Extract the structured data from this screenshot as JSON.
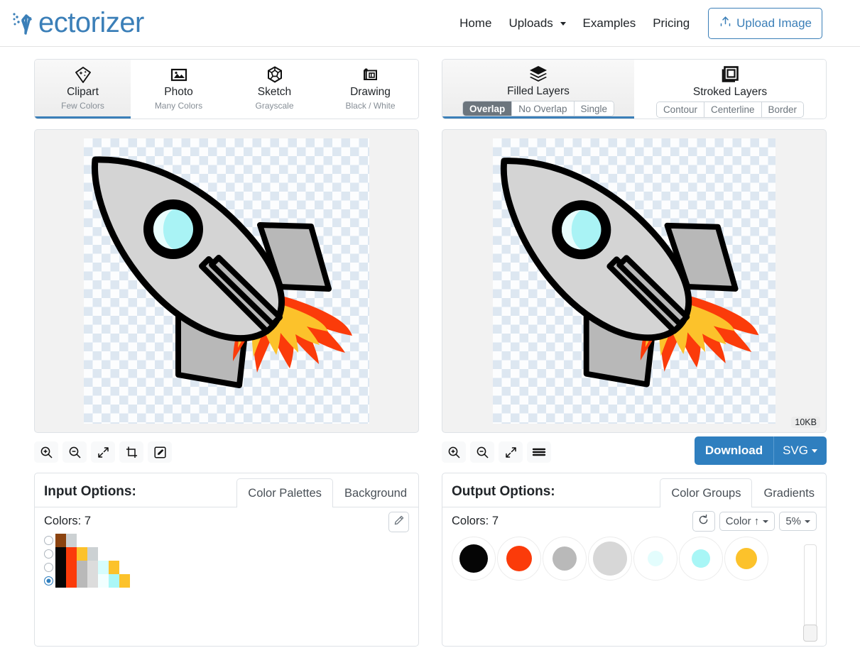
{
  "header": {
    "logo_text": "ectorizer",
    "logo_icon": "vectorizer-arrow-logo",
    "nav": [
      {
        "label": "Home",
        "caret": false
      },
      {
        "label": "Uploads",
        "caret": true
      },
      {
        "label": "Examples",
        "caret": false
      },
      {
        "label": "Pricing",
        "caret": false
      }
    ],
    "upload_button": "Upload Image",
    "upload_icon": "upload-arrow-icon"
  },
  "input_modes": [
    {
      "label": "Clipart",
      "sub": "Few Colors",
      "icon": "diamond-sparkle-icon",
      "active": true
    },
    {
      "label": "Photo",
      "sub": "Many Colors",
      "icon": "photo-icon",
      "active": false
    },
    {
      "label": "Sketch",
      "sub": "Grayscale",
      "icon": "hexagon-sketch-icon",
      "active": false
    },
    {
      "label": "Drawing",
      "sub": "Black / White",
      "icon": "blueprint-icon",
      "active": false
    }
  ],
  "output_modes": [
    {
      "label": "Filled Layers",
      "icon": "stacked-layers-icon",
      "active": true,
      "segments": [
        {
          "label": "Overlap",
          "on": true
        },
        {
          "label": "No Overlap",
          "on": false
        },
        {
          "label": "Single",
          "on": false
        }
      ]
    },
    {
      "label": "Stroked Layers",
      "icon": "nested-squares-icon",
      "active": false,
      "segments": [
        {
          "label": "Contour",
          "on": false
        },
        {
          "label": "Centerline",
          "on": false
        },
        {
          "label": "Border",
          "on": false
        }
      ]
    }
  ],
  "input_toolbar": [
    {
      "icon": "zoom-in-icon"
    },
    {
      "icon": "zoom-out-icon"
    },
    {
      "icon": "fit-expand-icon"
    },
    {
      "icon": "crop-icon"
    },
    {
      "icon": "edit-pencil-icon"
    }
  ],
  "output_toolbar": [
    {
      "icon": "zoom-in-icon"
    },
    {
      "icon": "zoom-out-icon"
    },
    {
      "icon": "fit-expand-icon"
    },
    {
      "icon": "hamburger-menu-icon"
    }
  ],
  "output_preview": {
    "size_badge": "10KB"
  },
  "download": {
    "label": "Download",
    "format": "SVG",
    "accent": "#2f7fbf"
  },
  "input_options": {
    "title": "Input Options:",
    "tabs": [
      {
        "label": "Color Palettes",
        "active": true
      },
      {
        "label": "Background",
        "active": false
      }
    ],
    "colors_label": "Colors: 7",
    "edit_icon": "pencil-icon",
    "palettes": [
      {
        "selected": false,
        "colors": [
          "#8b4310",
          "#ccd1d3"
        ]
      },
      {
        "selected": false,
        "colors": [
          "#060606",
          "#fb3b0a",
          "#fcc22b",
          "#ccd1d3"
        ]
      },
      {
        "selected": false,
        "colors": [
          "#060606",
          "#fb3b0a",
          "#b9b9b9",
          "#dcdcdc",
          "#d6fdfd",
          "#fcc22b"
        ]
      },
      {
        "selected": true,
        "colors": [
          "#060606",
          "#fb3b0a",
          "#b9b9b9",
          "#dcdcdc",
          "#f2ffff",
          "#aaf7f7",
          "#fcc22b"
        ]
      }
    ]
  },
  "output_options": {
    "title": "Output Options:",
    "tabs": [
      {
        "label": "Color Groups",
        "active": true
      },
      {
        "label": "Gradients",
        "active": false
      }
    ],
    "colors_label": "Colors: 7",
    "reset_icon": "reset-circular-arrow-icon",
    "sort_label": "Color ↑",
    "percent_label": "5%",
    "groups": [
      {
        "color": "#050505",
        "size": 40
      },
      {
        "color": "#fb3b0a",
        "size": 36
      },
      {
        "color": "#b9b9b9",
        "size": 34
      },
      {
        "color": "#d7d7d7",
        "size": 48
      },
      {
        "color": "#e3fdfd",
        "size": 22
      },
      {
        "color": "#a8f6f6",
        "size": 26
      },
      {
        "color": "#fcc22b",
        "size": 30
      }
    ]
  },
  "artwork": {
    "name": "rocket-clipart",
    "body_color": "#d4d4d4",
    "fin_color": "#b8b8b8",
    "outline_color": "#000000",
    "window_ring": "#000000",
    "window_glass": "#a9f3f5",
    "window_highlight": "#e8fdfd",
    "flame_outer": "#fb3b0a",
    "flame_inner": "#fcc22b"
  }
}
